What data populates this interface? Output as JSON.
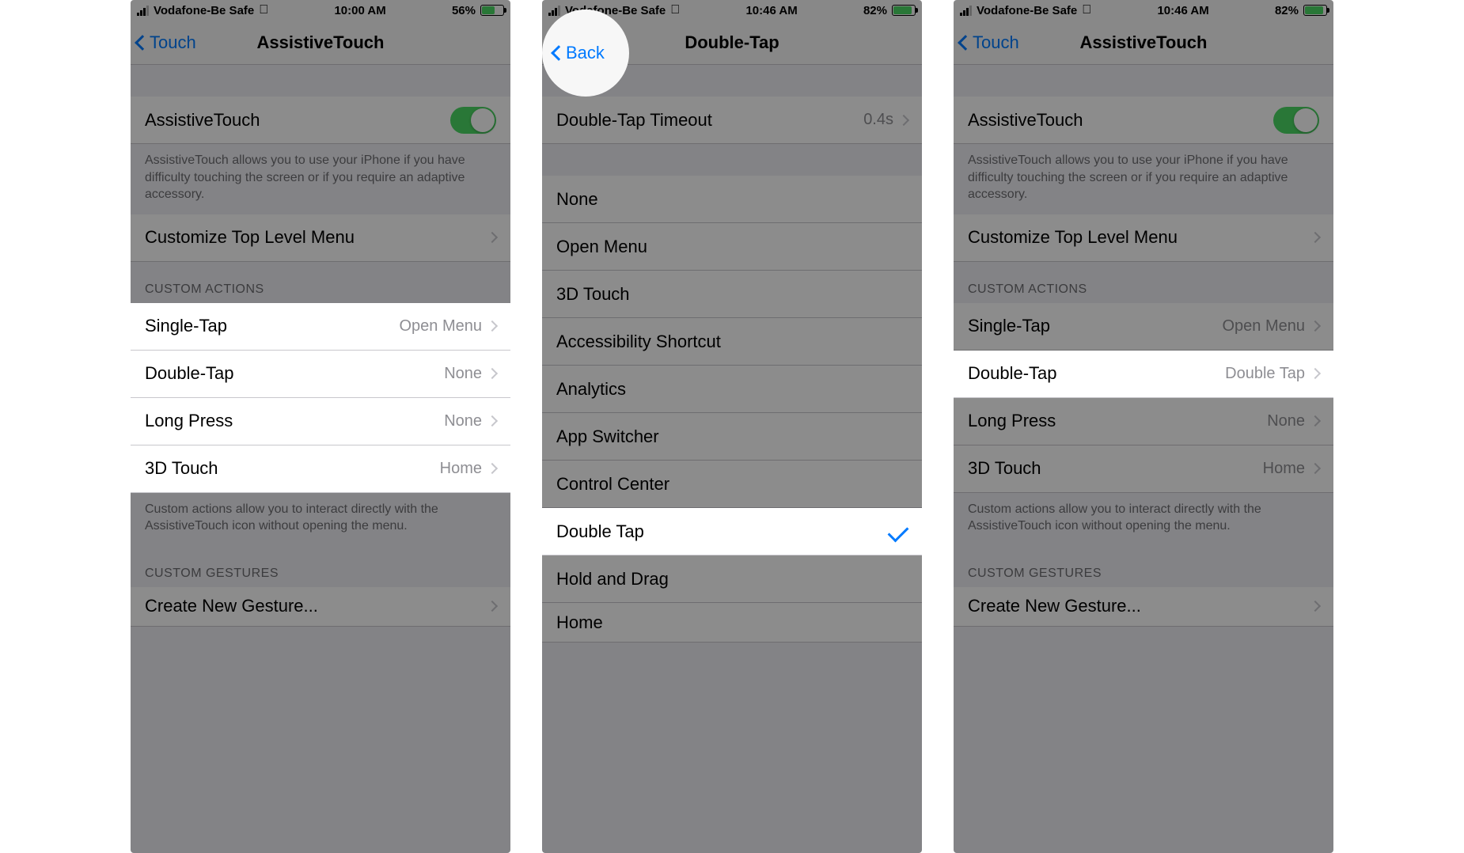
{
  "screens": {
    "a": {
      "status": {
        "carrier": "Vodafone-Be Safe",
        "time": "10:00 AM",
        "battery_pct": "56%",
        "battery_fill": 56
      },
      "nav": {
        "back": "Touch",
        "title": "AssistiveTouch"
      },
      "toggle_row": {
        "label": "AssistiveTouch"
      },
      "toggle_footer": "AssistiveTouch allows you to use your iPhone if you have difficulty touching the screen or if you require an adaptive accessory.",
      "customize_row": "Customize Top Level Menu",
      "actions_header": "CUSTOM ACTIONS",
      "actions": [
        {
          "label": "Single-Tap",
          "value": "Open Menu"
        },
        {
          "label": "Double-Tap",
          "value": "None"
        },
        {
          "label": "Long Press",
          "value": "None"
        },
        {
          "label": "3D Touch",
          "value": "Home"
        }
      ],
      "actions_footer": "Custom actions allow you to interact directly with the AssistiveTouch icon without opening the menu.",
      "gestures_header": "CUSTOM GESTURES",
      "gesture_row": "Create New Gesture..."
    },
    "b": {
      "status": {
        "carrier": "Vodafone-Be Safe",
        "time": "10:46 AM",
        "battery_pct": "82%",
        "battery_fill": 82
      },
      "nav": {
        "back": "Back",
        "title": "Double-Tap"
      },
      "timeout_row": {
        "label": "Double-Tap Timeout",
        "value": "0.4s"
      },
      "options": [
        {
          "label": "None",
          "checked": false
        },
        {
          "label": "Open Menu",
          "checked": false
        },
        {
          "label": "3D Touch",
          "checked": false
        },
        {
          "label": "Accessibility Shortcut",
          "checked": false
        },
        {
          "label": "Analytics",
          "checked": false
        },
        {
          "label": "App Switcher",
          "checked": false
        },
        {
          "label": "Control Center",
          "checked": false
        },
        {
          "label": "Double Tap",
          "checked": true
        },
        {
          "label": "Hold and Drag",
          "checked": false
        },
        {
          "label": "Home",
          "checked": false
        }
      ]
    },
    "c": {
      "status": {
        "carrier": "Vodafone-Be Safe",
        "time": "10:46 AM",
        "battery_pct": "82%",
        "battery_fill": 82
      },
      "nav": {
        "back": "Touch",
        "title": "AssistiveTouch"
      },
      "toggle_row": {
        "label": "AssistiveTouch"
      },
      "toggle_footer": "AssistiveTouch allows you to use your iPhone if you have difficulty touching the screen or if you require an adaptive accessory.",
      "customize_row": "Customize Top Level Menu",
      "actions_header": "CUSTOM ACTIONS",
      "actions": [
        {
          "label": "Single-Tap",
          "value": "Open Menu",
          "hl": false
        },
        {
          "label": "Double-Tap",
          "value": "Double Tap",
          "hl": true
        },
        {
          "label": "Long Press",
          "value": "None",
          "hl": false
        },
        {
          "label": "3D Touch",
          "value": "Home",
          "hl": false
        }
      ],
      "actions_footer": "Custom actions allow you to interact directly with the AssistiveTouch icon without opening the menu.",
      "gestures_header": "CUSTOM GESTURES",
      "gesture_row": "Create New Gesture..."
    }
  }
}
